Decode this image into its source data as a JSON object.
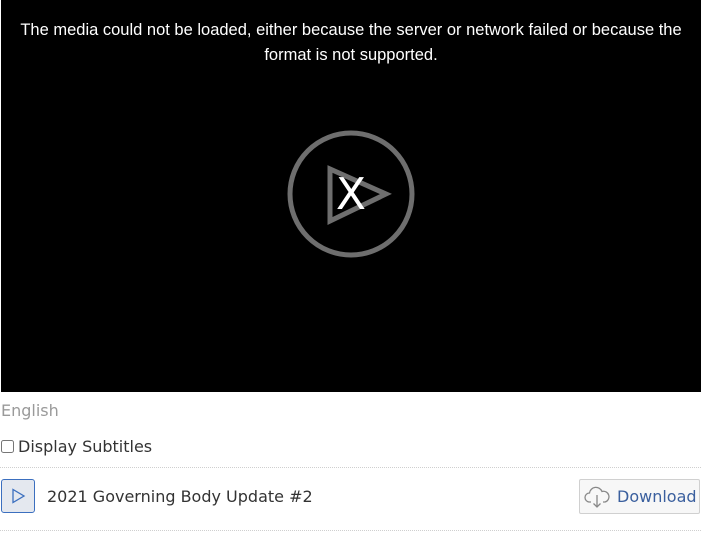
{
  "player": {
    "error_message": "The media could not be loaded, either because the server or network failed or because the format is not supported.",
    "big_play_icon": "play-error-icon",
    "error_mark": "X"
  },
  "language": {
    "label": "English"
  },
  "subtitles": {
    "label": "Display Subtitles",
    "checked": false
  },
  "track": {
    "play_icon": "play-icon",
    "title": "2021 Governing Body Update #2",
    "download_icon": "cloud-download-icon",
    "download_label": "Download"
  },
  "colors": {
    "player_background": "#000000",
    "link_blue": "#3a5f9e",
    "play_button_border": "#3b6fbf",
    "muted_text": "#9a9a9a"
  }
}
